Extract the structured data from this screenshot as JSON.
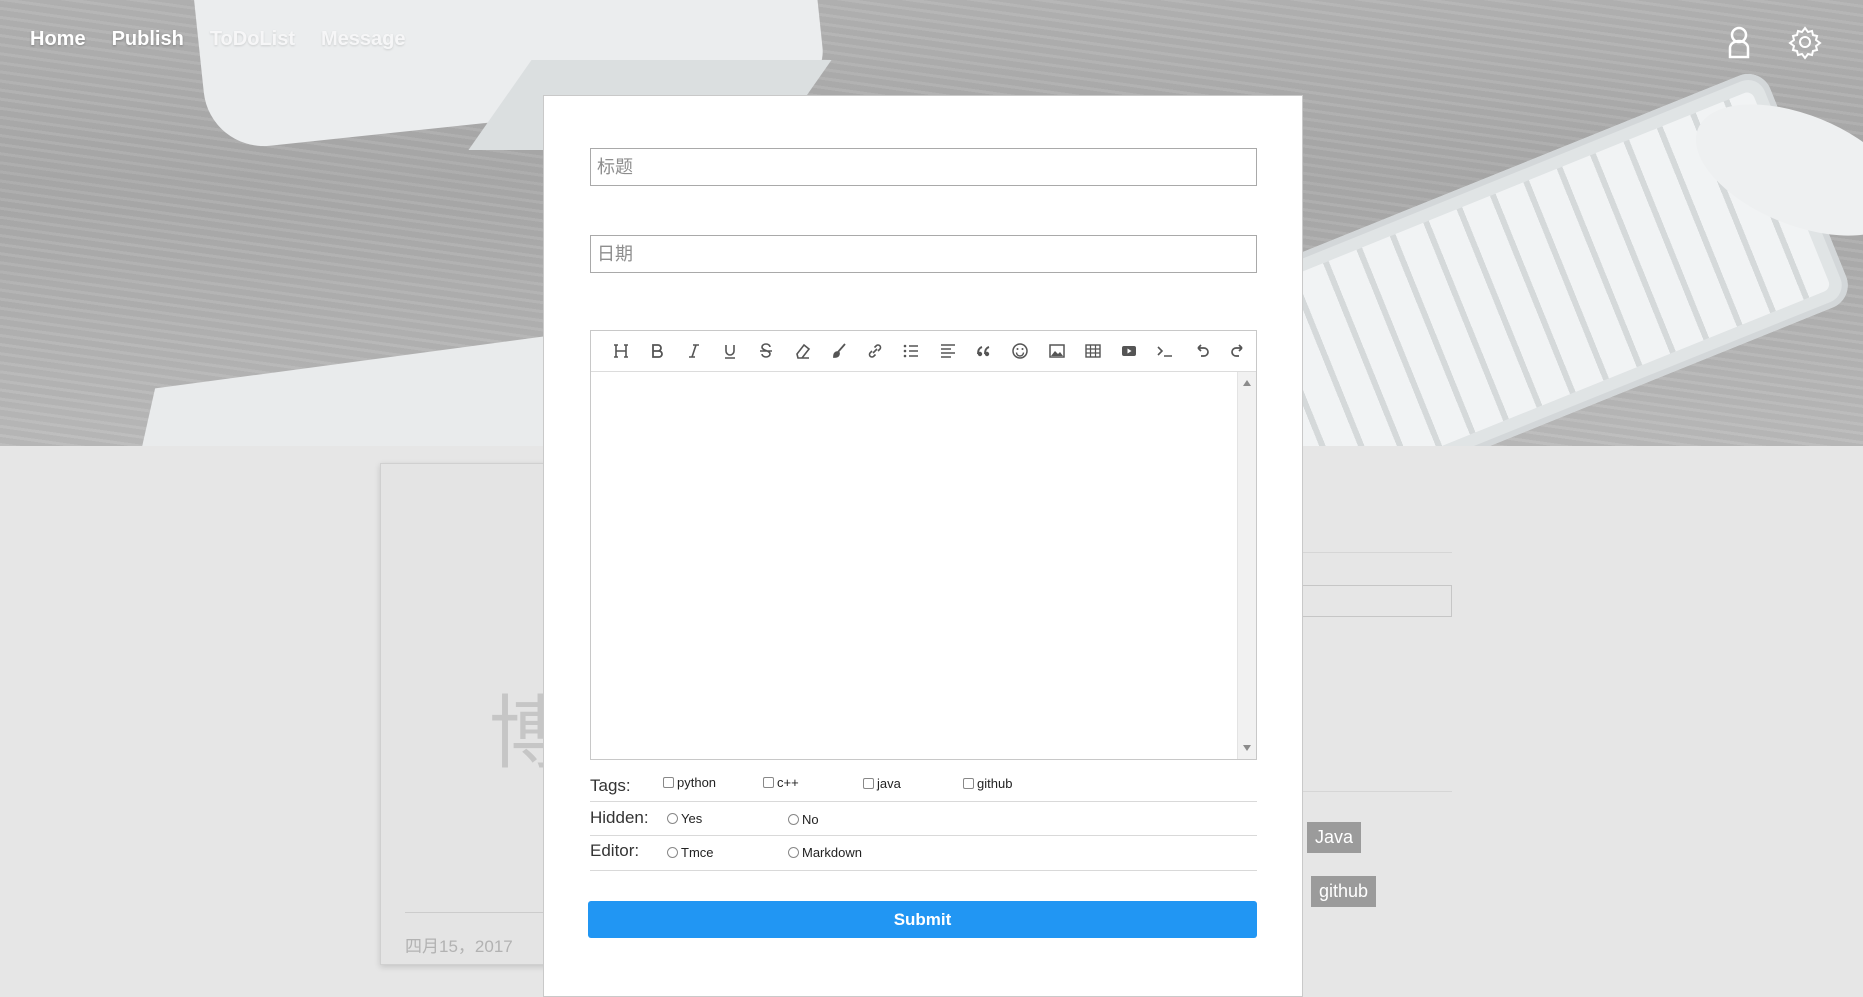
{
  "nav": {
    "items": [
      "Home",
      "Publish",
      "ToDoList",
      "Message"
    ]
  },
  "top_icons": [
    "user-icon",
    "gear-icon"
  ],
  "background": {
    "post_big_char": "博",
    "post_date": "四月15，2017",
    "tags": [
      "Java",
      "github"
    ]
  },
  "form": {
    "title_placeholder": "标题",
    "date_placeholder": "日期",
    "toolbar": [
      "heading-icon",
      "bold-icon",
      "italic-icon",
      "underline-icon",
      "strikethrough-icon",
      "eraser-icon",
      "brush-icon",
      "link-icon",
      "list-icon",
      "align-icon",
      "quote-icon",
      "emoji-icon",
      "image-icon",
      "table-icon",
      "video-icon",
      "code-icon",
      "undo-icon",
      "redo-icon"
    ],
    "tags_label": "Tags:",
    "tags": [
      "python",
      "c++",
      "java",
      "github"
    ],
    "hidden_label": "Hidden:",
    "hidden_options": [
      "Yes",
      "No"
    ],
    "editor_label": "Editor:",
    "editor_options": [
      "Tmce",
      "Markdown"
    ],
    "submit_label": "Submit"
  },
  "colors": {
    "accent": "#2196f3",
    "overlay": "#e6e6e6"
  }
}
